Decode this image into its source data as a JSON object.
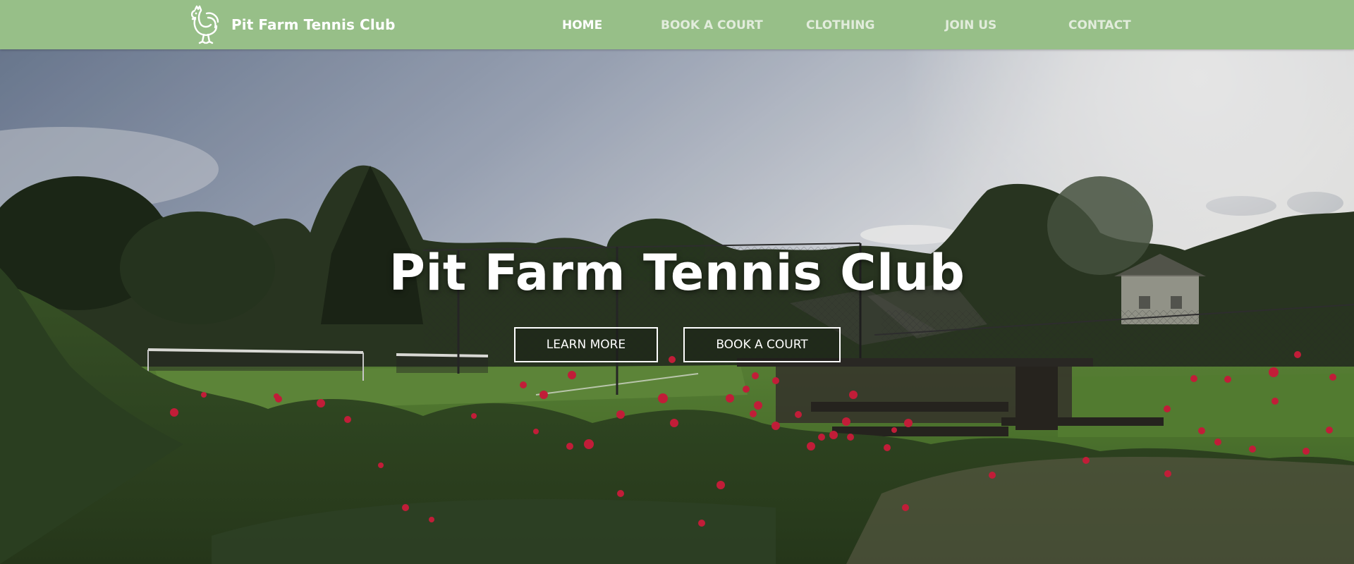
{
  "brand": {
    "name": "Pit Farm Tennis Club",
    "logo_icon": "rooster-icon"
  },
  "nav": {
    "items": [
      {
        "label": "HOME",
        "active": true
      },
      {
        "label": "BOOK A COURT",
        "active": false
      },
      {
        "label": "CLOTHING",
        "active": false
      },
      {
        "label": "JOIN US",
        "active": false
      },
      {
        "label": "CONTACT",
        "active": false
      }
    ]
  },
  "hero": {
    "title": "Pit Farm Tennis Club",
    "buttons": {
      "learn_more": "LEARN MORE",
      "book_court": "BOOK A COURT"
    }
  },
  "colors": {
    "nav_bg": "#97bf88",
    "text": "#ffffff",
    "grass": "#4f7a2e",
    "flowers": "#d8223f"
  }
}
